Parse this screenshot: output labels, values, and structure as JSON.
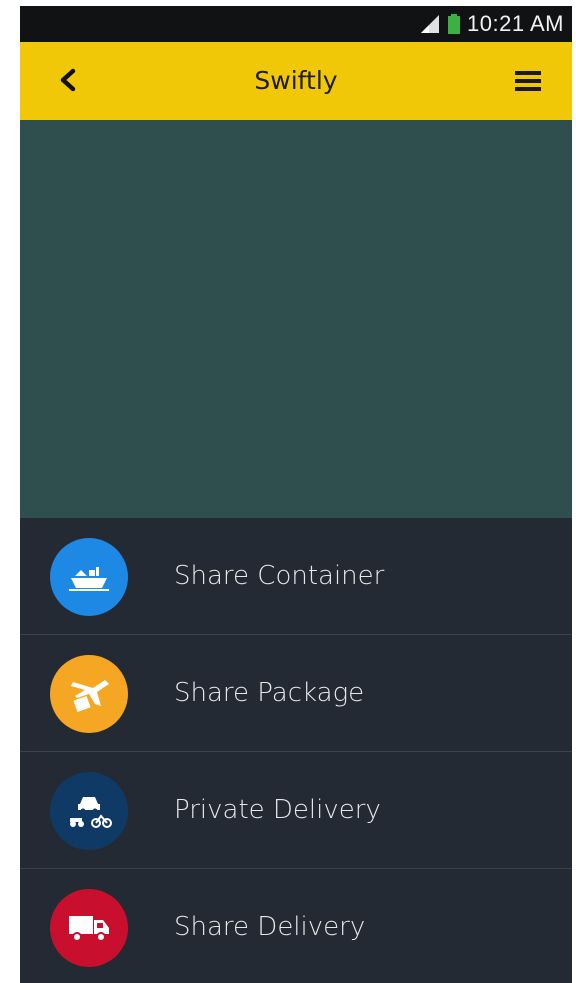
{
  "status_bar": {
    "time": "10:21 AM",
    "icons": [
      "signal-icon",
      "battery-icon"
    ]
  },
  "app_bar": {
    "title": "Swiftly",
    "back_icon": "chevron-left-icon",
    "menu_icon": "hamburger-menu-icon",
    "color": "#f0c808"
  },
  "map": {
    "color": "#2f4f4f"
  },
  "options": [
    {
      "label": "Share Container",
      "icon": "ship-icon",
      "color": "#1e88e5"
    },
    {
      "label": "Share Package",
      "icon": "plane-package-icon",
      "color": "#f5a623"
    },
    {
      "label": "Private Delivery",
      "icon": "car-bike-icon",
      "color": "#103a66"
    },
    {
      "label": "Share Delivery",
      "icon": "truck-icon",
      "color": "#c8102e"
    }
  ]
}
